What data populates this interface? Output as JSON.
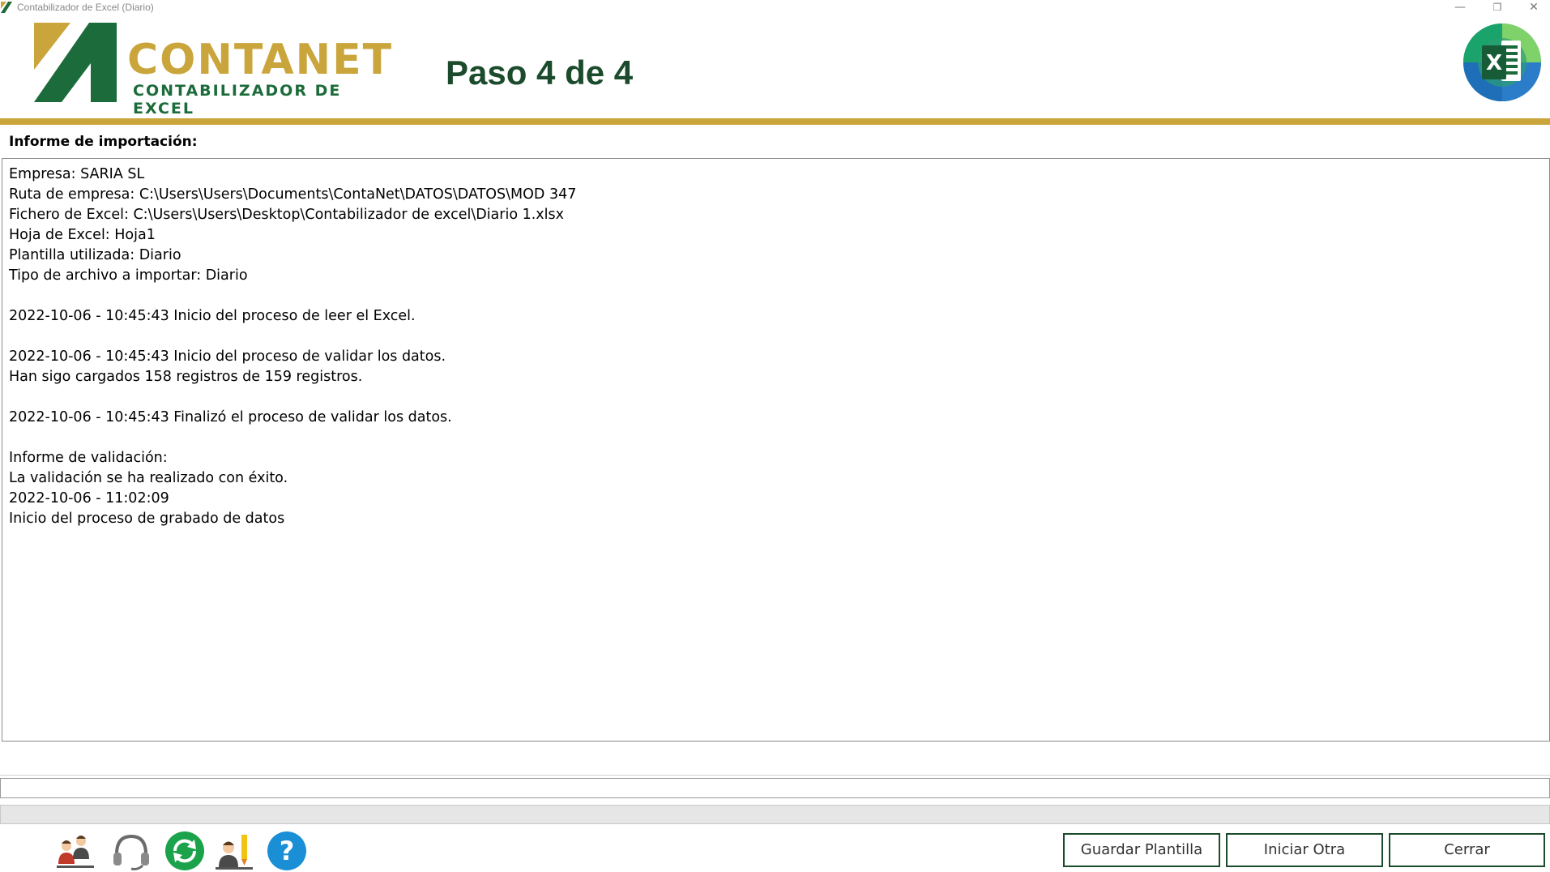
{
  "window": {
    "title": "Contabilizador de Excel (Diario)",
    "minimize_symbol": "—",
    "restore_symbol": "❐",
    "close_symbol": "✕",
    "app_icon": "contanet-icon"
  },
  "header": {
    "logo_main": "CONTANET",
    "logo_sub": "CONTABILIZADOR DE EXCEL",
    "step_title": "Paso 4 de 4",
    "excel_logo_letter": "X"
  },
  "report": {
    "label": "Informe de importación:",
    "lines": [
      "Empresa: SARIA SL",
      "Ruta de empresa: C:\\Users\\Users\\Documents\\ContaNet\\DATOS\\DATOS\\MOD 347",
      "Fichero de Excel: C:\\Users\\Users\\Desktop\\Contabilizador de excel\\Diario 1.xlsx",
      "Hoja de Excel: Hoja1",
      "Plantilla utilizada: Diario",
      "Tipo de archivo a importar: Diario",
      "",
      "2022-10-06 - 10:45:43 Inicio del proceso de leer el Excel.",
      "",
      "2022-10-06 - 10:45:43 Inicio del proceso de validar los datos.",
      "Han sigo cargados 158 registros de 159 registros.",
      "",
      "2022-10-06 - 10:45:43 Finalizó el proceso de validar los datos.",
      "",
      "Informe de validación:",
      "La validación se ha realizado con éxito.",
      "2022-10-06 - 11:02:09",
      "Inicio del proceso de grabado de datos"
    ]
  },
  "status": {
    "input_value": "",
    "progress": 0
  },
  "toolbar": {
    "icons": [
      "users-icon",
      "support-headset-icon",
      "refresh-icon",
      "edit-user-icon",
      "help-icon"
    ],
    "help_glyph": "?"
  },
  "buttons": {
    "save_template": "Guardar Plantilla",
    "start_another": "Iniciar Otra",
    "close": "Cerrar"
  },
  "colors": {
    "brand_gold": "#c9a53b",
    "brand_green": "#1c6b3a",
    "title_green": "#1b4b2c",
    "help_blue": "#1a8fd6",
    "refresh_green": "#1aa34a"
  }
}
